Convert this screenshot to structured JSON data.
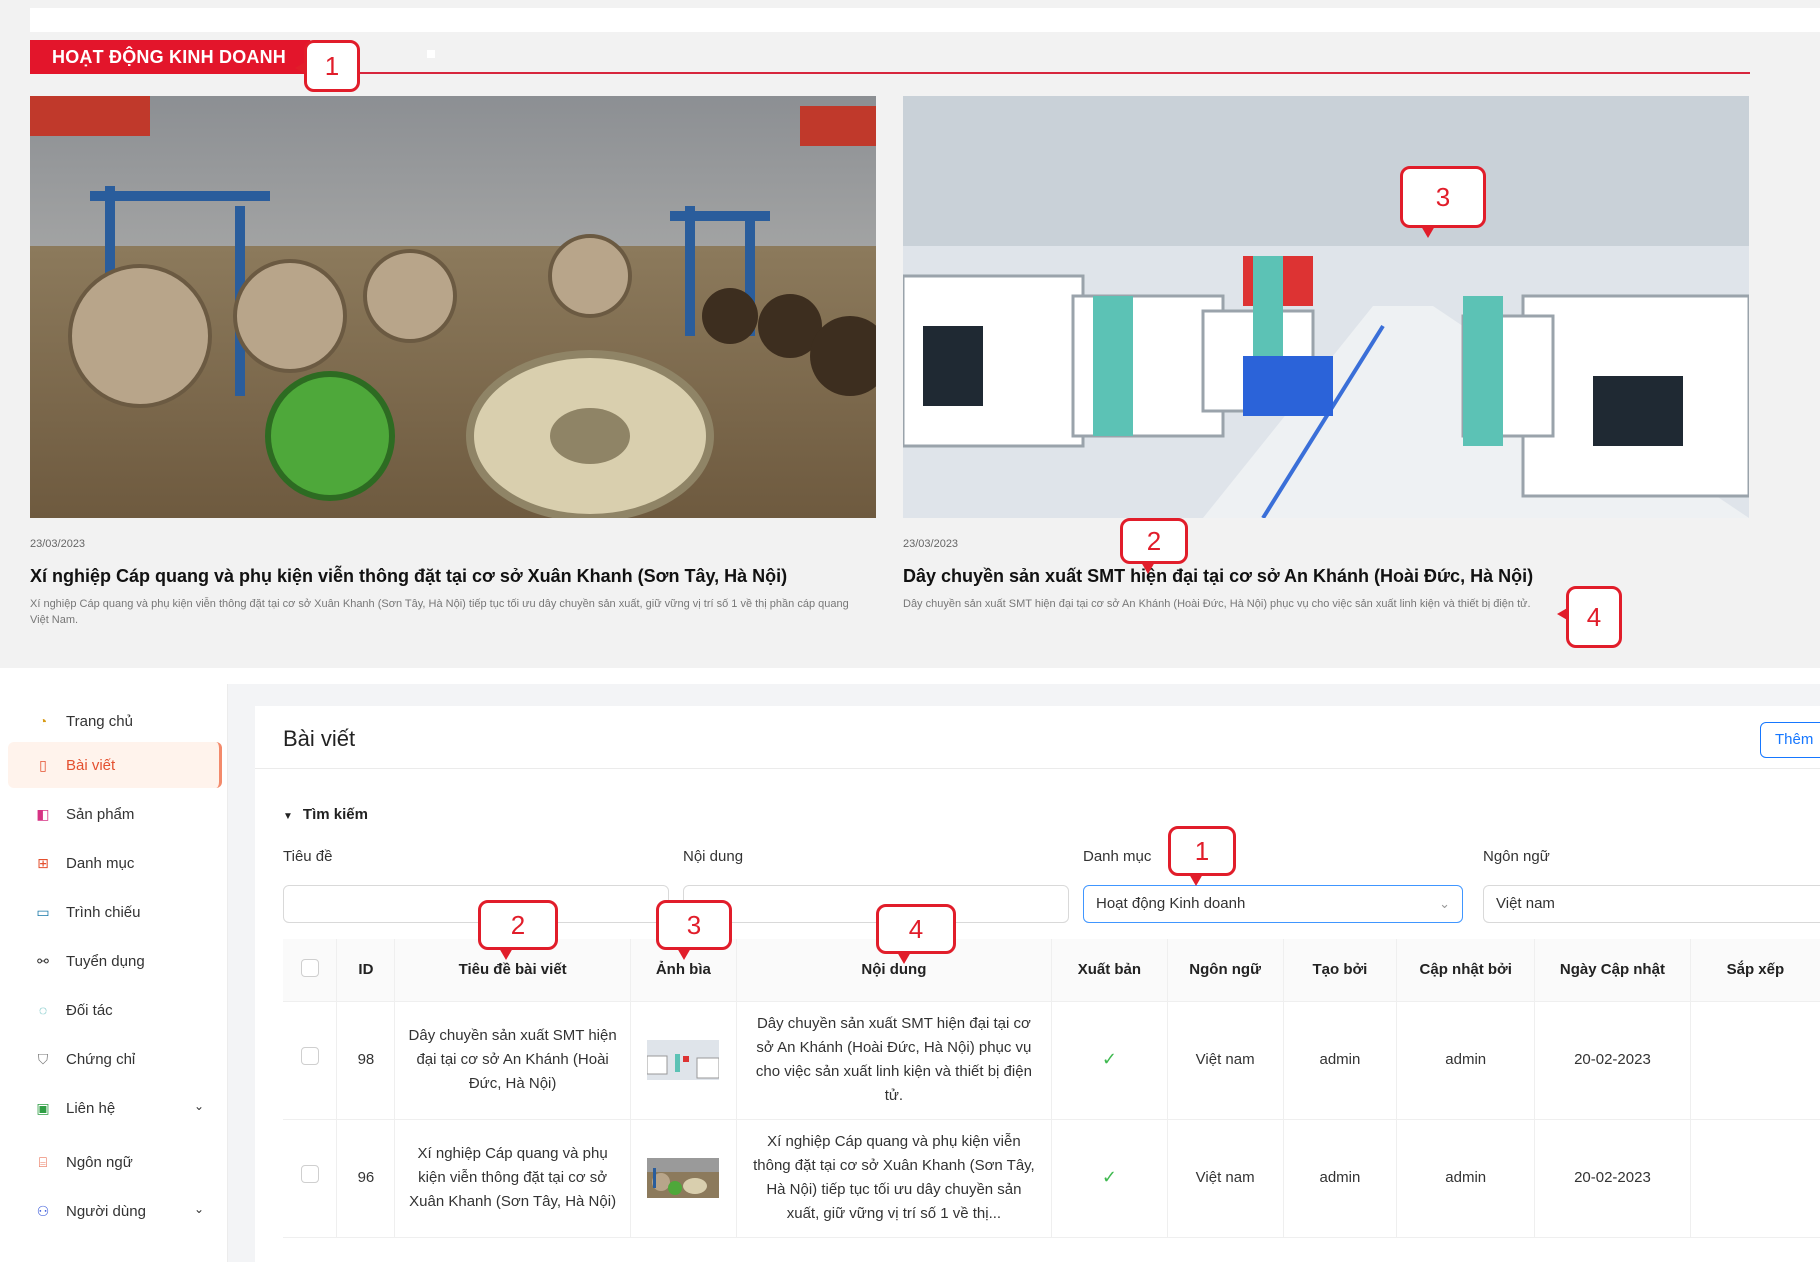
{
  "site": {
    "section_title": "HOẠT ĐỘNG KINH DOANH",
    "articles": [
      {
        "date": "23/03/2023",
        "title": "Xí nghiệp Cáp quang và phụ kiện viễn thông đặt tại cơ sở Xuân Khanh (Sơn Tây, Hà Nội)",
        "description": "Xí nghiệp Cáp quang và phụ kiện viễn thông đặt tại cơ sở Xuân Khanh (Sơn Tây, Hà Nội) tiếp tục tối ưu dây chuyền sản xuất, giữ vững vị trí số 1 về thị phần cáp quang Việt Nam."
      },
      {
        "date": "23/03/2023",
        "title": "Dây chuyền sản xuất SMT hiện đại tại cơ sở An Khánh (Hoài Đức, Hà Nội)",
        "description": "Dây chuyền sản xuất SMT hiện đại tại cơ sở An Khánh (Hoài Đức, Hà Nội) phục vụ cho việc sản xuất linh kiện và thiết bị điện tử."
      }
    ],
    "callouts": [
      "1",
      "2",
      "3",
      "4"
    ]
  },
  "sidebar": {
    "items": [
      {
        "label": "Trang chủ",
        "icon": "dashboard-icon"
      },
      {
        "label": "Bài viết",
        "icon": "document-icon",
        "active": true
      },
      {
        "label": "Sản phẩm",
        "icon": "shopping-bag-icon"
      },
      {
        "label": "Danh mục",
        "icon": "cluster-icon"
      },
      {
        "label": "Trình chiếu",
        "icon": "desktop-icon"
      },
      {
        "label": "Tuyển dụng",
        "icon": "link-icon"
      },
      {
        "label": "Đối tác",
        "icon": "message-icon"
      },
      {
        "label": "Chứng chỉ",
        "icon": "shield-icon"
      },
      {
        "label": "Liên hệ",
        "icon": "contacts-icon",
        "expandable": true
      },
      {
        "label": "Ngôn ngữ",
        "icon": "translate-icon"
      },
      {
        "label": "Người dùng",
        "icon": "users-icon",
        "expandable": true
      }
    ]
  },
  "main": {
    "page_title": "Bài viết",
    "add_button": "Thêm",
    "search_toggle": "Tìm kiếm",
    "filters": {
      "title_label": "Tiêu đề",
      "title_value": "",
      "content_label": "Nội dung",
      "content_value": "",
      "category_label": "Danh mục",
      "category_value": "Hoạt động Kinh doanh",
      "language_label": "Ngôn ngữ",
      "language_value": "Việt nam"
    },
    "callouts": [
      "1",
      "2",
      "3",
      "4"
    ],
    "table": {
      "columns": [
        "ID",
        "Tiêu đề bài viết",
        "Ảnh bìa",
        "Nội dung",
        "Xuất bản",
        "Ngôn ngữ",
        "Tạo bởi",
        "Cập nhật bởi",
        "Ngày Cập nhật",
        "Sắp xếp"
      ],
      "rows": [
        {
          "id": "98",
          "title": "Dây chuyền sản xuất SMT hiện đại tại cơ sở An Khánh (Hoài Đức, Hà Nội)",
          "content": "Dây chuyền sản xuất SMT hiện đại tại cơ sở An Khánh (Hoài Đức, Hà Nội) phục vụ cho việc sản xuất linh kiện và thiết bị điện tử.",
          "published": "✓",
          "language": "Việt nam",
          "created_by": "admin",
          "updated_by": "admin",
          "updated_date": "20-02-2023"
        },
        {
          "id": "96",
          "title": "Xí nghiệp Cáp quang và phụ kiện viễn thông đặt tại cơ sở Xuân Khanh (Sơn Tây, Hà Nội)",
          "content": "Xí nghiệp Cáp quang và phụ kiện viễn thông đặt tại cơ sở Xuân Khanh (Sơn Tây, Hà Nội) tiếp tục tối ưu dây chuyền sản xuất, giữ vững vị trí số 1 về thị...",
          "published": "✓",
          "language": "Việt nam",
          "created_by": "admin",
          "updated_by": "admin",
          "updated_date": "20-02-2023"
        }
      ]
    }
  }
}
